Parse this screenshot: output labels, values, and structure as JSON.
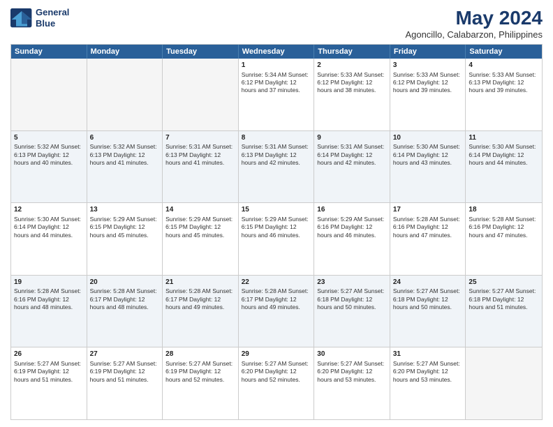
{
  "logo": {
    "line1": "General",
    "line2": "Blue"
  },
  "title": "May 2024",
  "subtitle": "Agoncillo, Calabarzon, Philippines",
  "dayHeaders": [
    "Sunday",
    "Monday",
    "Tuesday",
    "Wednesday",
    "Thursday",
    "Friday",
    "Saturday"
  ],
  "rows": [
    [
      {
        "date": "",
        "info": "",
        "empty": true
      },
      {
        "date": "",
        "info": "",
        "empty": true
      },
      {
        "date": "",
        "info": "",
        "empty": true
      },
      {
        "date": "1",
        "info": "Sunrise: 5:34 AM\nSunset: 6:12 PM\nDaylight: 12 hours\nand 37 minutes."
      },
      {
        "date": "2",
        "info": "Sunrise: 5:33 AM\nSunset: 6:12 PM\nDaylight: 12 hours\nand 38 minutes."
      },
      {
        "date": "3",
        "info": "Sunrise: 5:33 AM\nSunset: 6:12 PM\nDaylight: 12 hours\nand 39 minutes."
      },
      {
        "date": "4",
        "info": "Sunrise: 5:33 AM\nSunset: 6:13 PM\nDaylight: 12 hours\nand 39 minutes."
      }
    ],
    [
      {
        "date": "5",
        "info": "Sunrise: 5:32 AM\nSunset: 6:13 PM\nDaylight: 12 hours\nand 40 minutes."
      },
      {
        "date": "6",
        "info": "Sunrise: 5:32 AM\nSunset: 6:13 PM\nDaylight: 12 hours\nand 41 minutes."
      },
      {
        "date": "7",
        "info": "Sunrise: 5:31 AM\nSunset: 6:13 PM\nDaylight: 12 hours\nand 41 minutes."
      },
      {
        "date": "8",
        "info": "Sunrise: 5:31 AM\nSunset: 6:13 PM\nDaylight: 12 hours\nand 42 minutes."
      },
      {
        "date": "9",
        "info": "Sunrise: 5:31 AM\nSunset: 6:14 PM\nDaylight: 12 hours\nand 42 minutes."
      },
      {
        "date": "10",
        "info": "Sunrise: 5:30 AM\nSunset: 6:14 PM\nDaylight: 12 hours\nand 43 minutes."
      },
      {
        "date": "11",
        "info": "Sunrise: 5:30 AM\nSunset: 6:14 PM\nDaylight: 12 hours\nand 44 minutes."
      }
    ],
    [
      {
        "date": "12",
        "info": "Sunrise: 5:30 AM\nSunset: 6:14 PM\nDaylight: 12 hours\nand 44 minutes."
      },
      {
        "date": "13",
        "info": "Sunrise: 5:29 AM\nSunset: 6:15 PM\nDaylight: 12 hours\nand 45 minutes."
      },
      {
        "date": "14",
        "info": "Sunrise: 5:29 AM\nSunset: 6:15 PM\nDaylight: 12 hours\nand 45 minutes."
      },
      {
        "date": "15",
        "info": "Sunrise: 5:29 AM\nSunset: 6:15 PM\nDaylight: 12 hours\nand 46 minutes."
      },
      {
        "date": "16",
        "info": "Sunrise: 5:29 AM\nSunset: 6:16 PM\nDaylight: 12 hours\nand 46 minutes."
      },
      {
        "date": "17",
        "info": "Sunrise: 5:28 AM\nSunset: 6:16 PM\nDaylight: 12 hours\nand 47 minutes."
      },
      {
        "date": "18",
        "info": "Sunrise: 5:28 AM\nSunset: 6:16 PM\nDaylight: 12 hours\nand 47 minutes."
      }
    ],
    [
      {
        "date": "19",
        "info": "Sunrise: 5:28 AM\nSunset: 6:16 PM\nDaylight: 12 hours\nand 48 minutes."
      },
      {
        "date": "20",
        "info": "Sunrise: 5:28 AM\nSunset: 6:17 PM\nDaylight: 12 hours\nand 48 minutes."
      },
      {
        "date": "21",
        "info": "Sunrise: 5:28 AM\nSunset: 6:17 PM\nDaylight: 12 hours\nand 49 minutes."
      },
      {
        "date": "22",
        "info": "Sunrise: 5:28 AM\nSunset: 6:17 PM\nDaylight: 12 hours\nand 49 minutes."
      },
      {
        "date": "23",
        "info": "Sunrise: 5:27 AM\nSunset: 6:18 PM\nDaylight: 12 hours\nand 50 minutes."
      },
      {
        "date": "24",
        "info": "Sunrise: 5:27 AM\nSunset: 6:18 PM\nDaylight: 12 hours\nand 50 minutes."
      },
      {
        "date": "25",
        "info": "Sunrise: 5:27 AM\nSunset: 6:18 PM\nDaylight: 12 hours\nand 51 minutes."
      }
    ],
    [
      {
        "date": "26",
        "info": "Sunrise: 5:27 AM\nSunset: 6:19 PM\nDaylight: 12 hours\nand 51 minutes."
      },
      {
        "date": "27",
        "info": "Sunrise: 5:27 AM\nSunset: 6:19 PM\nDaylight: 12 hours\nand 51 minutes."
      },
      {
        "date": "28",
        "info": "Sunrise: 5:27 AM\nSunset: 6:19 PM\nDaylight: 12 hours\nand 52 minutes."
      },
      {
        "date": "29",
        "info": "Sunrise: 5:27 AM\nSunset: 6:20 PM\nDaylight: 12 hours\nand 52 minutes."
      },
      {
        "date": "30",
        "info": "Sunrise: 5:27 AM\nSunset: 6:20 PM\nDaylight: 12 hours\nand 53 minutes."
      },
      {
        "date": "31",
        "info": "Sunrise: 5:27 AM\nSunset: 6:20 PM\nDaylight: 12 hours\nand 53 minutes."
      },
      {
        "date": "",
        "info": "",
        "empty": true
      }
    ]
  ]
}
